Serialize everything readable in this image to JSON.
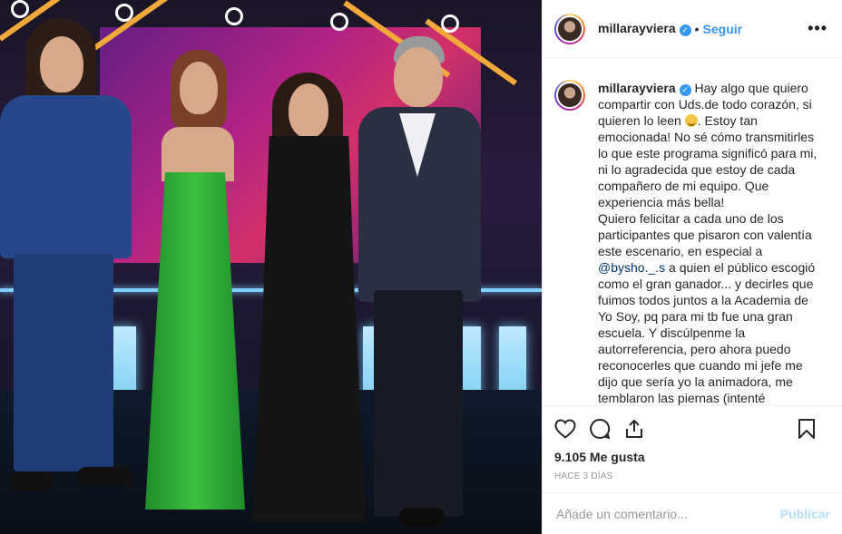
{
  "post": {
    "username": "millarayviera",
    "verified_glyph": "✓",
    "separator": "•",
    "follow_label": "Seguir",
    "more_label": "•••",
    "photo_icon": "tv-set-photo",
    "caption": {
      "username": "millarayviera",
      "part1": "Hay algo que quiero compartir con Uds.de todo corazón, si quieren lo leen ",
      "emoji": "smile-emoji",
      "part2": ". Estoy tan emocionada! No sé cómo transmitirles lo que este programa significó para mi, ni lo agradecida que estoy de cada compañero de mi equipo. Que experiencia más bella!",
      "part3": "Quiero felicitar a cada uno de los participantes que pisaron con valentía este escenario, en especial a ",
      "mention": "@bysho._.s",
      "part4": " a quien el público escogió como el gran ganador... y decirles que fuimos todos juntos a la Academia de Yo Soy, pq para mi tb fue una gran escuela. Y discúlpenme la autorreferencia, pero ahora puedo reconocerles que cuando mi jefe me dijo que sería yo la animadora, me temblaron las piernas (intenté"
    },
    "likes_text": "9.105 Me gusta",
    "time_text": "HACE 3 DÍAS",
    "comment_placeholder": "Añade un comentario...",
    "publish_label": "Publicar",
    "colors": {
      "link_blue": "#3897f0",
      "publish_disabled": "#b2dffc",
      "mention": "#003569",
      "text": "#262626"
    }
  }
}
